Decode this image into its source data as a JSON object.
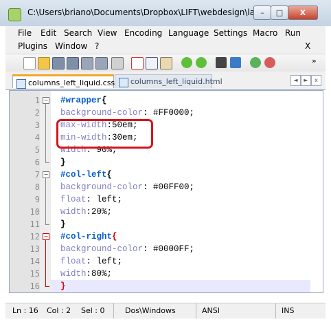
{
  "window": {
    "title": "C:\\Users\\briano\\Documents\\Dropbox\\LIFT\\webdesign\\layo...",
    "minimize_glyph": "–",
    "maximize_glyph": "□",
    "close_glyph": "X"
  },
  "menu": {
    "row1": [
      "File",
      "Edit",
      "Search",
      "View",
      "Encoding",
      "Language",
      "Settings",
      "Macro",
      "Run"
    ],
    "row2": [
      "Plugins",
      "Window",
      "?"
    ],
    "close_doc": "X"
  },
  "toolbar": {
    "icons": [
      "new-file-icon",
      "open-file-icon",
      "save-icon",
      "save-all-icon",
      "close-icon",
      "close-all-icon",
      "print-icon",
      "cut-icon",
      "copy-icon",
      "paste-icon",
      "undo-icon",
      "redo-icon",
      "find-icon",
      "replace-icon",
      "zoom-in-icon",
      "zoom-out-icon"
    ],
    "overflow": "»"
  },
  "tabs": [
    {
      "label": "columns_left_liquid.css",
      "active": true
    },
    {
      "label": "columns_left_liquid.html",
      "active": false
    }
  ],
  "tab_nav": {
    "left": "◄",
    "right": "►",
    "close": "x"
  },
  "editor": {
    "lines": [
      {
        "n": "1",
        "tokens": [
          {
            "t": "#wrapper",
            "c": "sel"
          },
          {
            "t": "{",
            "c": "brace"
          }
        ]
      },
      {
        "n": "2",
        "tokens": [
          {
            "t": "background-color",
            "c": "prop"
          },
          {
            "t": ": #FF0000;",
            "c": "val"
          }
        ]
      },
      {
        "n": "3",
        "tokens": [
          {
            "t": "max-width",
            "c": "prop"
          },
          {
            "t": ":50em;",
            "c": "val"
          }
        ]
      },
      {
        "n": "4",
        "tokens": [
          {
            "t": "min-width",
            "c": "prop"
          },
          {
            "t": ":30em;",
            "c": "val"
          }
        ]
      },
      {
        "n": "5",
        "tokens": [
          {
            "t": "width",
            "c": "prop"
          },
          {
            "t": ": 90%;",
            "c": "val"
          }
        ]
      },
      {
        "n": "6",
        "tokens": [
          {
            "t": "}",
            "c": "brace"
          }
        ]
      },
      {
        "n": "7",
        "tokens": [
          {
            "t": "#col-left",
            "c": "sel"
          },
          {
            "t": "{",
            "c": "brace"
          }
        ]
      },
      {
        "n": "8",
        "tokens": [
          {
            "t": "background-color",
            "c": "prop"
          },
          {
            "t": ": #00FF00;",
            "c": "val"
          }
        ]
      },
      {
        "n": "9",
        "tokens": [
          {
            "t": "float",
            "c": "prop"
          },
          {
            "t": ": left;",
            "c": "val"
          }
        ]
      },
      {
        "n": "10",
        "tokens": [
          {
            "t": "width",
            "c": "prop"
          },
          {
            "t": ":20%;",
            "c": "val"
          }
        ]
      },
      {
        "n": "11",
        "tokens": [
          {
            "t": "}",
            "c": "brace"
          }
        ]
      },
      {
        "n": "12",
        "tokens": [
          {
            "t": "#col-right",
            "c": "sel"
          },
          {
            "t": "{",
            "c": "brace-hl"
          }
        ]
      },
      {
        "n": "13",
        "tokens": [
          {
            "t": "background-color",
            "c": "prop"
          },
          {
            "t": ": #0000FF;",
            "c": "val"
          }
        ]
      },
      {
        "n": "14",
        "tokens": [
          {
            "t": "float",
            "c": "prop"
          },
          {
            "t": ": left;",
            "c": "val"
          }
        ]
      },
      {
        "n": "15",
        "tokens": [
          {
            "t": "width",
            "c": "prop"
          },
          {
            "t": ":80%;",
            "c": "val"
          }
        ]
      },
      {
        "n": "16",
        "tokens": [
          {
            "t": "}",
            "c": "brace-hl"
          }
        ]
      }
    ],
    "current_line": "16",
    "highlight_color": "#d6141c"
  },
  "status": {
    "ln": "Ln : 16",
    "col": "Col : 2",
    "sel": "Sel : 0",
    "eol": "Dos\\Windows",
    "encoding": "ANSI",
    "mode": "INS"
  }
}
